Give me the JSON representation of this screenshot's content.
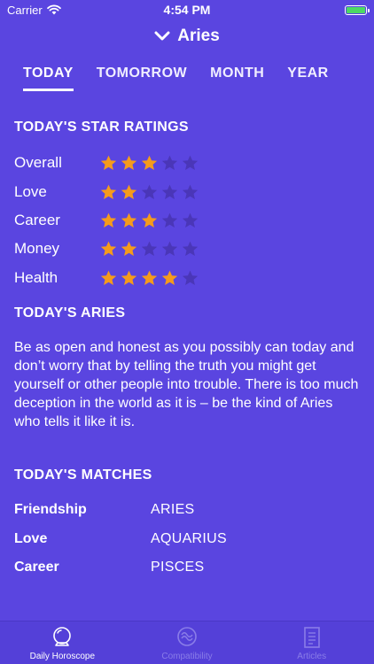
{
  "status_bar": {
    "carrier": "Carrier",
    "time": "4:54 PM",
    "battery_color": "#4cd964"
  },
  "nav": {
    "title": "Aries",
    "chevron_icon": "chevron-down-icon"
  },
  "tabs": [
    {
      "label": "TODAY",
      "active": true
    },
    {
      "label": "TOMORROW",
      "active": false
    },
    {
      "label": "MONTH",
      "active": false
    },
    {
      "label": "YEAR",
      "active": false
    }
  ],
  "star_ratings": {
    "heading": "TODAY'S STAR RATINGS",
    "max": 5,
    "items": [
      {
        "label": "Overall",
        "value": 3
      },
      {
        "label": "Love",
        "value": 2
      },
      {
        "label": "Career",
        "value": 3
      },
      {
        "label": "Money",
        "value": 2
      },
      {
        "label": "Health",
        "value": 4
      }
    ]
  },
  "reading": {
    "heading": "TODAY'S ARIES",
    "text": "Be as open and honest as you possibly can today and don’t worry that by telling the truth you might get yourself or other people into trouble. There is too much deception in the world as it is – be the kind of Aries who tells it like it is."
  },
  "matches": {
    "heading": "TODAY'S MATCHES",
    "items": [
      {
        "label": "Friendship",
        "value": "ARIES"
      },
      {
        "label": "Love",
        "value": "AQUARIUS"
      },
      {
        "label": "Career",
        "value": "PISCES"
      }
    ]
  },
  "tab_bar": [
    {
      "label": "Daily Horoscope",
      "icon": "crystal-ball-icon",
      "active": true
    },
    {
      "label": "Compatibility",
      "icon": "compatibility-icon",
      "active": false
    },
    {
      "label": "Articles",
      "icon": "article-icon",
      "active": false
    }
  ],
  "colors": {
    "background": "#5a45e0",
    "star_on": "#f59b1c",
    "star_off": "#4a36b8"
  }
}
